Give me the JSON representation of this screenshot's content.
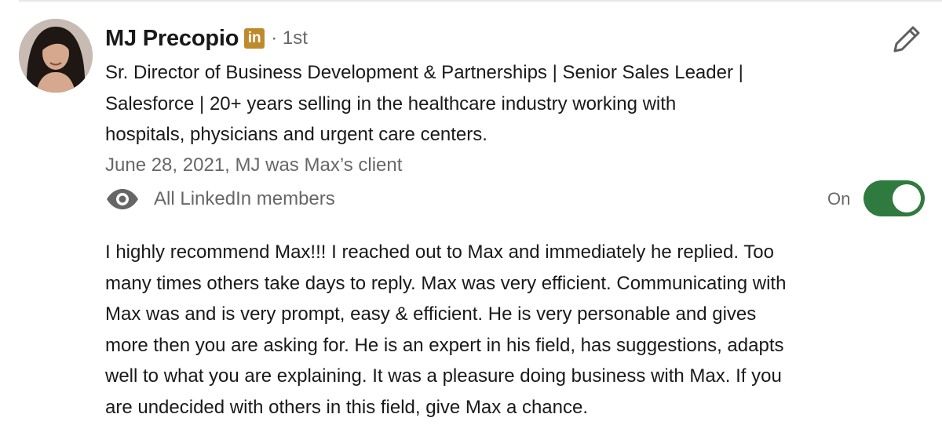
{
  "recommendation": {
    "author": {
      "name": "MJ Precopio",
      "badge": "in",
      "degree": "· 1st",
      "headline_lines": [
        "Sr. Director of Business Development & Partnerships | Senior Sales Leader |",
        "Salesforce | 20+ years selling in the healthcare industry working with",
        "hospitals, physicians and urgent care centers."
      ]
    },
    "meta": "June 28, 2021, MJ was Max’s client",
    "visibility": {
      "icon": "eye-icon",
      "label": "All LinkedIn members",
      "toggle_label": "On",
      "toggle_on": true
    },
    "edit_icon": "pencil-icon",
    "text_lines": [
      "I highly recommend Max!!! I reached out to Max and immediately he replied. Too",
      "many times others take days to reply. Max was very efficient. Communicating with",
      "Max was and is very prompt, easy & efficient. He is very personable and gives",
      "more then you are asking for. He is an expert in his field, has suggestions, adapts",
      "well to what you are explaining. It was a pleasure doing business with Max. If you",
      "are undecided with others in this field, give Max a chance."
    ]
  },
  "colors": {
    "badge_gold": "#bf8a2c",
    "toggle_green": "#2f7a3f",
    "text_primary": "rgba(0,0,0,0.9)",
    "text_secondary": "rgba(0,0,0,0.6)"
  }
}
